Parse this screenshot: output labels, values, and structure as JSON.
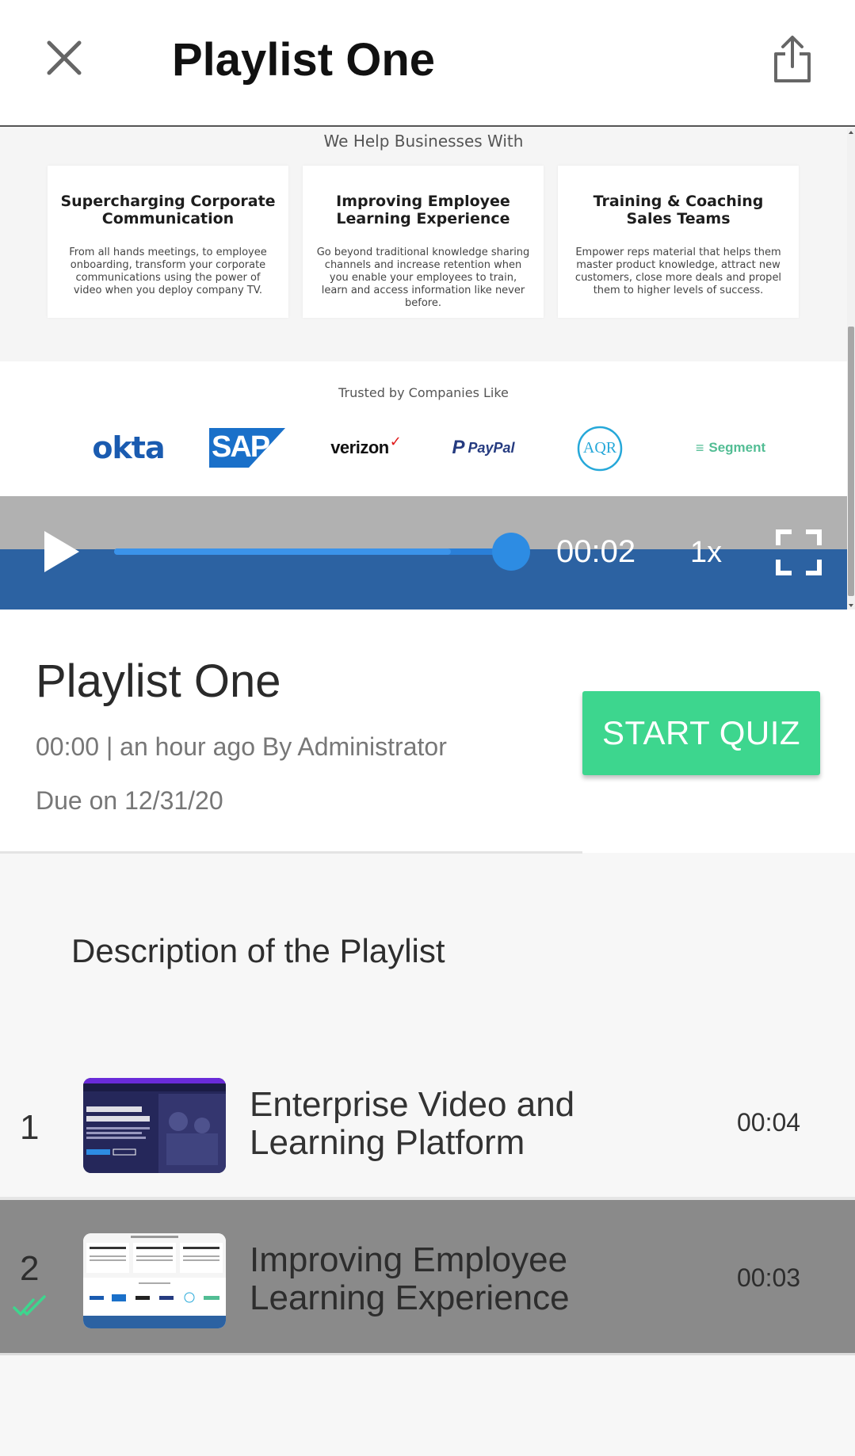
{
  "header": {
    "title": "Playlist One",
    "close_icon": "close-icon",
    "share_icon": "share-icon"
  },
  "video": {
    "slide": {
      "heading": "We Help Businesses With",
      "cards": [
        {
          "title": "Supercharging Corporate Communication",
          "text": "From all hands meetings, to employee onboarding, transform your corporate communications using the power of video when you deploy company TV."
        },
        {
          "title": "Improving Employee Learning Experience",
          "text": "Go beyond traditional knowledge sharing channels and increase retention when you enable your employees to train, learn and access information like never before."
        },
        {
          "title": "Training & Coaching Sales Teams",
          "text": "Empower reps material that helps them master product knowledge, attract new customers, close more deals and propel them to higher levels of success."
        }
      ],
      "trusted_title": "Trusted by Companies Like",
      "logos": [
        "okta",
        "SAP",
        "verizon",
        "PayPal",
        "AQR",
        "Segment"
      ]
    },
    "controls": {
      "time": "00:02",
      "speed": "1x",
      "progress_fraction": 0.85,
      "play_icon": "play-icon",
      "fullscreen_icon": "fullscreen-icon"
    }
  },
  "info": {
    "title": "Playlist One",
    "meta": "00:00 | an hour ago By Administrator",
    "due": "Due on 12/31/20",
    "quiz_button": "START QUIZ"
  },
  "description": "Description of the Playlist",
  "items": [
    {
      "number": "1",
      "title": "Enterprise Video and Learning Platform",
      "duration": "00:04",
      "completed": false
    },
    {
      "number": "2",
      "title": "Improving Employee Learning Experience",
      "duration": "00:03",
      "completed": true
    }
  ],
  "colors": {
    "accent_green": "#3dd68e",
    "player_bar": "#2c62a2",
    "progress": "#2d8ce3",
    "selected_item": "#8a8a8a"
  }
}
